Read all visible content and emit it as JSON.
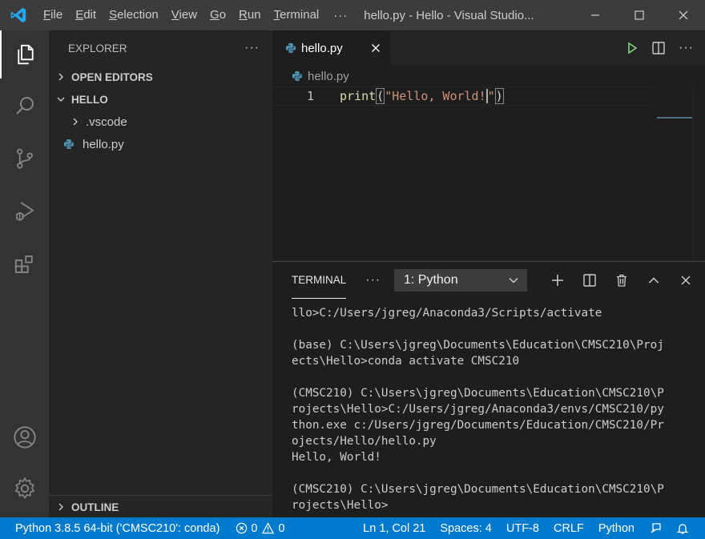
{
  "titlebar": {
    "menu": [
      {
        "first": "F",
        "rest": "ile"
      },
      {
        "first": "E",
        "rest": "dit"
      },
      {
        "first": "S",
        "rest": "election"
      },
      {
        "first": "V",
        "rest": "iew"
      },
      {
        "first": "G",
        "rest": "o"
      },
      {
        "first": "R",
        "rest": "un"
      },
      {
        "first": "T",
        "rest": "erminal"
      }
    ],
    "more": "···",
    "window_title": "hello.py - Hello - Visual Studio..."
  },
  "activity_bar": {
    "items": [
      "files-icon",
      "search-icon",
      "source-control-icon",
      "run-debug-icon",
      "extensions-icon"
    ],
    "bottom": [
      "account-icon",
      "manage-gear-icon"
    ],
    "active": "files-icon"
  },
  "sidebar": {
    "title": "EXPLORER",
    "more": "···",
    "open_editors": "OPEN EDITORS",
    "folder": "HELLO",
    "tree": [
      {
        "type": "folder",
        "label": ".vscode"
      },
      {
        "type": "python-file",
        "label": "hello.py"
      }
    ],
    "outline": "OUTLINE"
  },
  "editor": {
    "tab_label": "hello.py",
    "breadcrumb": "hello.py",
    "line_number": "1",
    "code": {
      "fn": "print",
      "open_paren": "(",
      "string_before_cursor": "\"Hello, World!",
      "string_after_cursor": "\"",
      "close_paren": ")"
    }
  },
  "panel": {
    "tab": "TERMINAL",
    "more": "···",
    "terminal_select": "1: Python",
    "terminal_lines": [
      "llo>C:/Users/jgreg/Anaconda3/Scripts/activate",
      "",
      "(base) C:\\Users\\jgreg\\Documents\\Education\\CMSC210\\Proj",
      "ects\\Hello>conda activate CMSC210",
      "",
      "(CMSC210) C:\\Users\\jgreg\\Documents\\Education\\CMSC210\\P",
      "rojects\\Hello>C:/Users/jgreg/Anaconda3/envs/CMSC210/py",
      "thon.exe c:/Users/jgreg/Documents/Education/CMSC210/Pr",
      "ojects/Hello/hello.py",
      "Hello, World!",
      "",
      "(CMSC210) C:\\Users\\jgreg\\Documents\\Education\\CMSC210\\P",
      "rojects\\Hello>"
    ]
  },
  "statusbar": {
    "interpreter": "Python 3.8.5 64-bit ('CMSC210': conda)",
    "errors": "0",
    "warnings": "0",
    "position": "Ln 1, Col 21",
    "spaces": "Spaces: 4",
    "encoding": "UTF-8",
    "eol": "CRLF",
    "language": "Python"
  },
  "colors": {
    "accent": "#007acc",
    "titlebar": "#3c3c3c",
    "activitybar": "#333333",
    "sidebar": "#252526",
    "editor": "#1e1e1e",
    "run": "#89d185"
  }
}
